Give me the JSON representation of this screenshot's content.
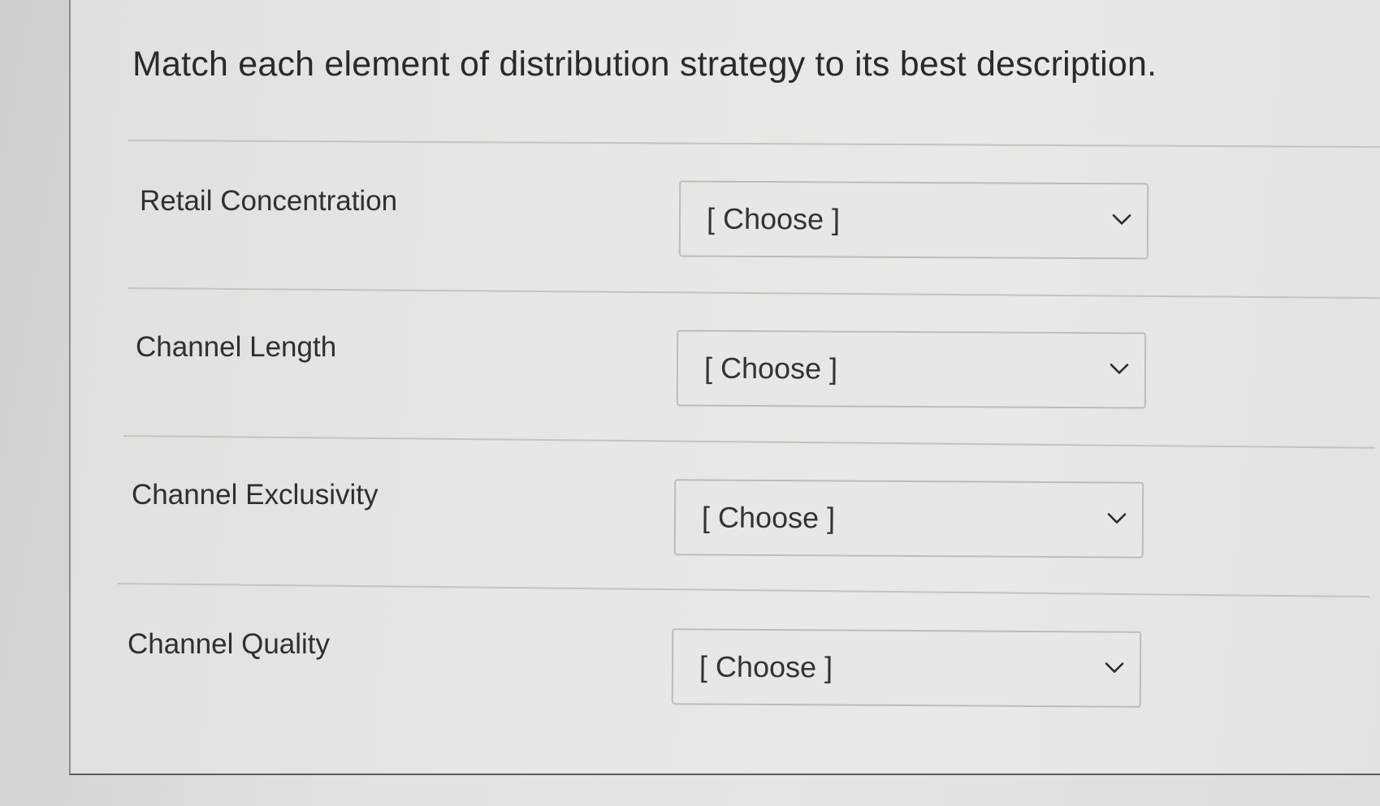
{
  "question": {
    "title": "Match each element of distribution strategy to its best description."
  },
  "rows": [
    {
      "label": "Retail Concentration",
      "selected": "[ Choose ]",
      "icon": "chevron-down-icon"
    },
    {
      "label": "Channel Length",
      "selected": "[ Choose ]",
      "icon": "chevron-down-icon"
    },
    {
      "label": "Channel Exclusivity",
      "selected": "[ Choose ]",
      "icon": "chevron-down-icon"
    },
    {
      "label": "Channel Quality",
      "selected": "[ Choose ]",
      "icon": "chevron-down-icon"
    }
  ]
}
